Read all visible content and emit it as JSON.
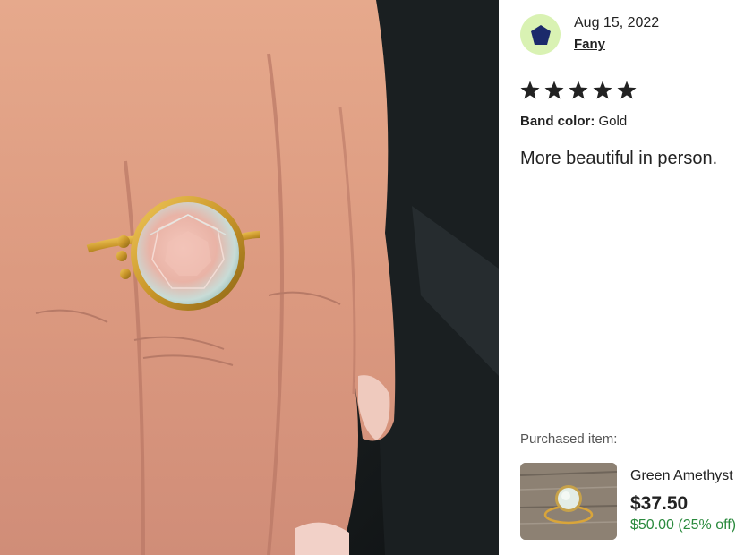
{
  "review": {
    "date": "Aug 15, 2022",
    "author": "Fany",
    "rating": 5,
    "rating_max": 5,
    "variation_label": "Band color",
    "variation_separator": ":",
    "variation_value": "Gold",
    "text": "More beautiful in person."
  },
  "avatar": {
    "icon": "pentagon-avatar-icon",
    "bg_color": "#d9f2b3",
    "fg_color": "#1b2a6b"
  },
  "purchase": {
    "label": "Purchased item:",
    "title": "Green Amethyst",
    "price": "$37.50",
    "original_price": "$50.00",
    "discount": "(25% off)"
  },
  "colors": {
    "star": "#222222",
    "discount_green": "#2a8a3d"
  }
}
